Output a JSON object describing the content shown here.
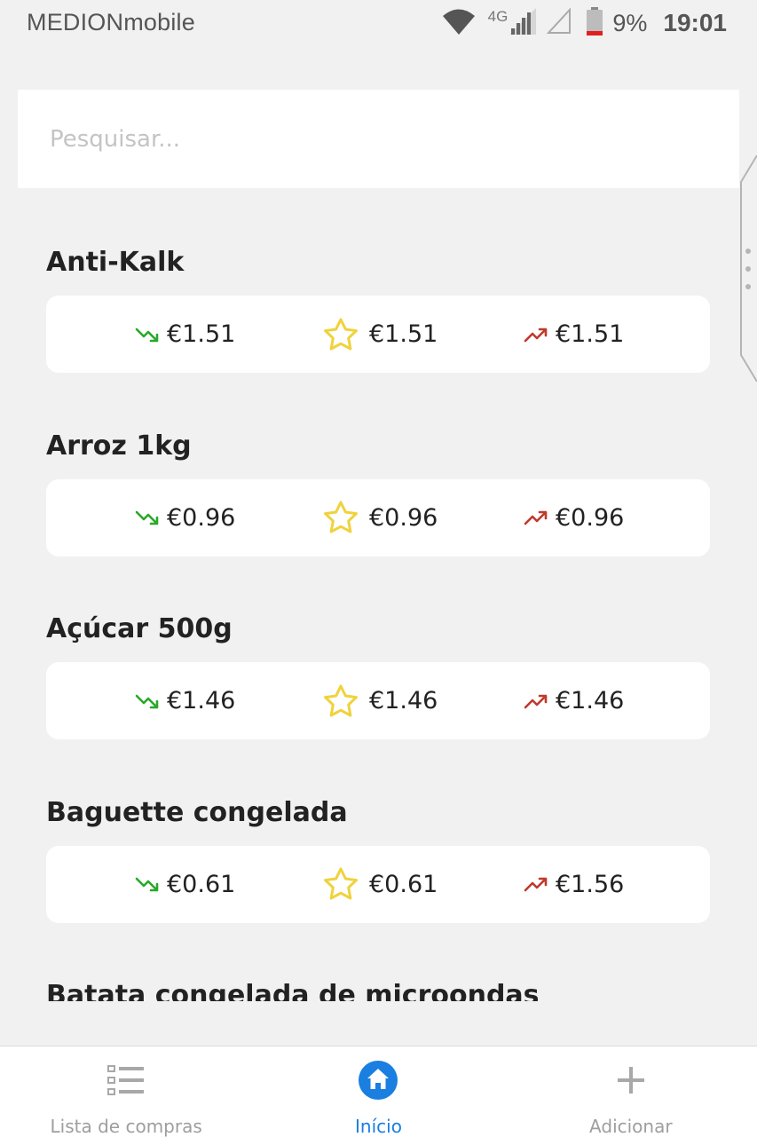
{
  "status_bar": {
    "carrier": "MEDIONmobile",
    "network": "4G",
    "battery": "9%",
    "time": "19:01",
    "icons": [
      "wifi-icon",
      "cell-signal-icon",
      "cell-signal-empty-icon",
      "battery-low-icon"
    ]
  },
  "search": {
    "placeholder": "Pesquisar..."
  },
  "colors": {
    "background": "#f1f1f1",
    "trend_down": "#2aa82a",
    "favorite_star": "#f0d23c",
    "trend_up": "#c0392b",
    "active_nav": "#1a7fe0",
    "inactive_nav": "#9e9e9e"
  },
  "products": [
    {
      "name": "Anti-Kalk",
      "min_price": "€1.51",
      "fav_price": "€1.51",
      "max_price": "€1.51"
    },
    {
      "name": "Arroz 1kg",
      "min_price": "€0.96",
      "fav_price": "€0.96",
      "max_price": "€0.96"
    },
    {
      "name": "Açúcar 500g",
      "min_price": "€1.46",
      "fav_price": "€1.46",
      "max_price": "€1.46"
    },
    {
      "name": "Baguette congelada",
      "min_price": "€0.61",
      "fav_price": "€0.61",
      "max_price": "€1.56"
    },
    {
      "name": "Batata congelada de microondas"
    }
  ],
  "bottom_nav": {
    "items": [
      {
        "label": "Lista de compras",
        "icon": "list-icon",
        "active": false
      },
      {
        "label": "Início",
        "icon": "home-icon",
        "active": true
      },
      {
        "label": "Adicionar",
        "icon": "plus-icon",
        "active": false
      }
    ]
  }
}
